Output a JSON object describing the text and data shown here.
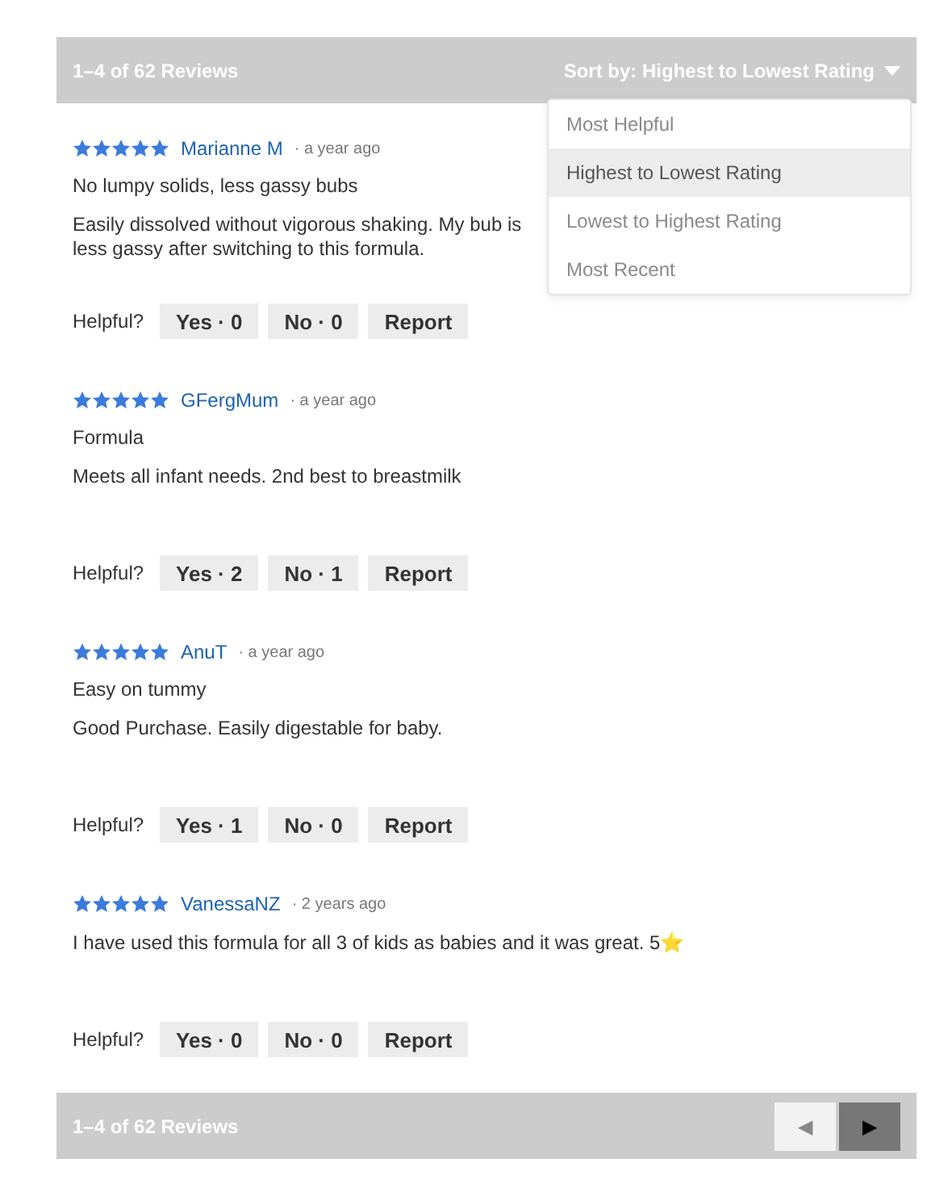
{
  "header": {
    "count": "1–4 of 62 Reviews",
    "sort_label": "Sort by: Highest to Lowest Rating"
  },
  "sort_options": [
    {
      "label": "Most Helpful",
      "selected": false
    },
    {
      "label": "Highest to Lowest Rating",
      "selected": true
    },
    {
      "label": "Lowest to Highest Rating",
      "selected": false
    },
    {
      "label": "Most Recent",
      "selected": false
    }
  ],
  "reviews": [
    {
      "stars": 5,
      "author": "Marianne M",
      "time": "· a year ago",
      "title": "No lumpy solids, less gassy bubs",
      "body": "Easily dissolved without vigorous shaking. My bub is less gassy after switching to this formula.",
      "helpful_label": "Helpful?",
      "yes": "Yes · 0",
      "no": "No · 0",
      "report": "Report"
    },
    {
      "stars": 5,
      "author": "GFergMum",
      "time": "· a year ago",
      "title": "Formula",
      "body": "Meets all infant needs. 2nd best to breastmilk",
      "helpful_label": "Helpful?",
      "yes": "Yes · 2",
      "no": "No · 1",
      "report": "Report"
    },
    {
      "stars": 5,
      "author": "AnuT",
      "time": "· a year ago",
      "title": "Easy on tummy",
      "body": "Good Purchase. Easily digestable for baby.",
      "helpful_label": "Helpful?",
      "yes": "Yes · 1",
      "no": "No · 0",
      "report": "Report"
    },
    {
      "stars": 5,
      "author": "VanessaNZ",
      "time": "· 2 years ago",
      "body": "I have used this formula for all 3 of kids as babies and it was great. 5⭐",
      "helpful_label": "Helpful?",
      "yes": "Yes · 0",
      "no": "No · 0",
      "report": "Report"
    }
  ],
  "footer": {
    "count": "1–4 of 62 Reviews",
    "prev": {
      "label": "◀",
      "disabled": true
    },
    "next": {
      "label": "▶",
      "disabled": false
    }
  }
}
